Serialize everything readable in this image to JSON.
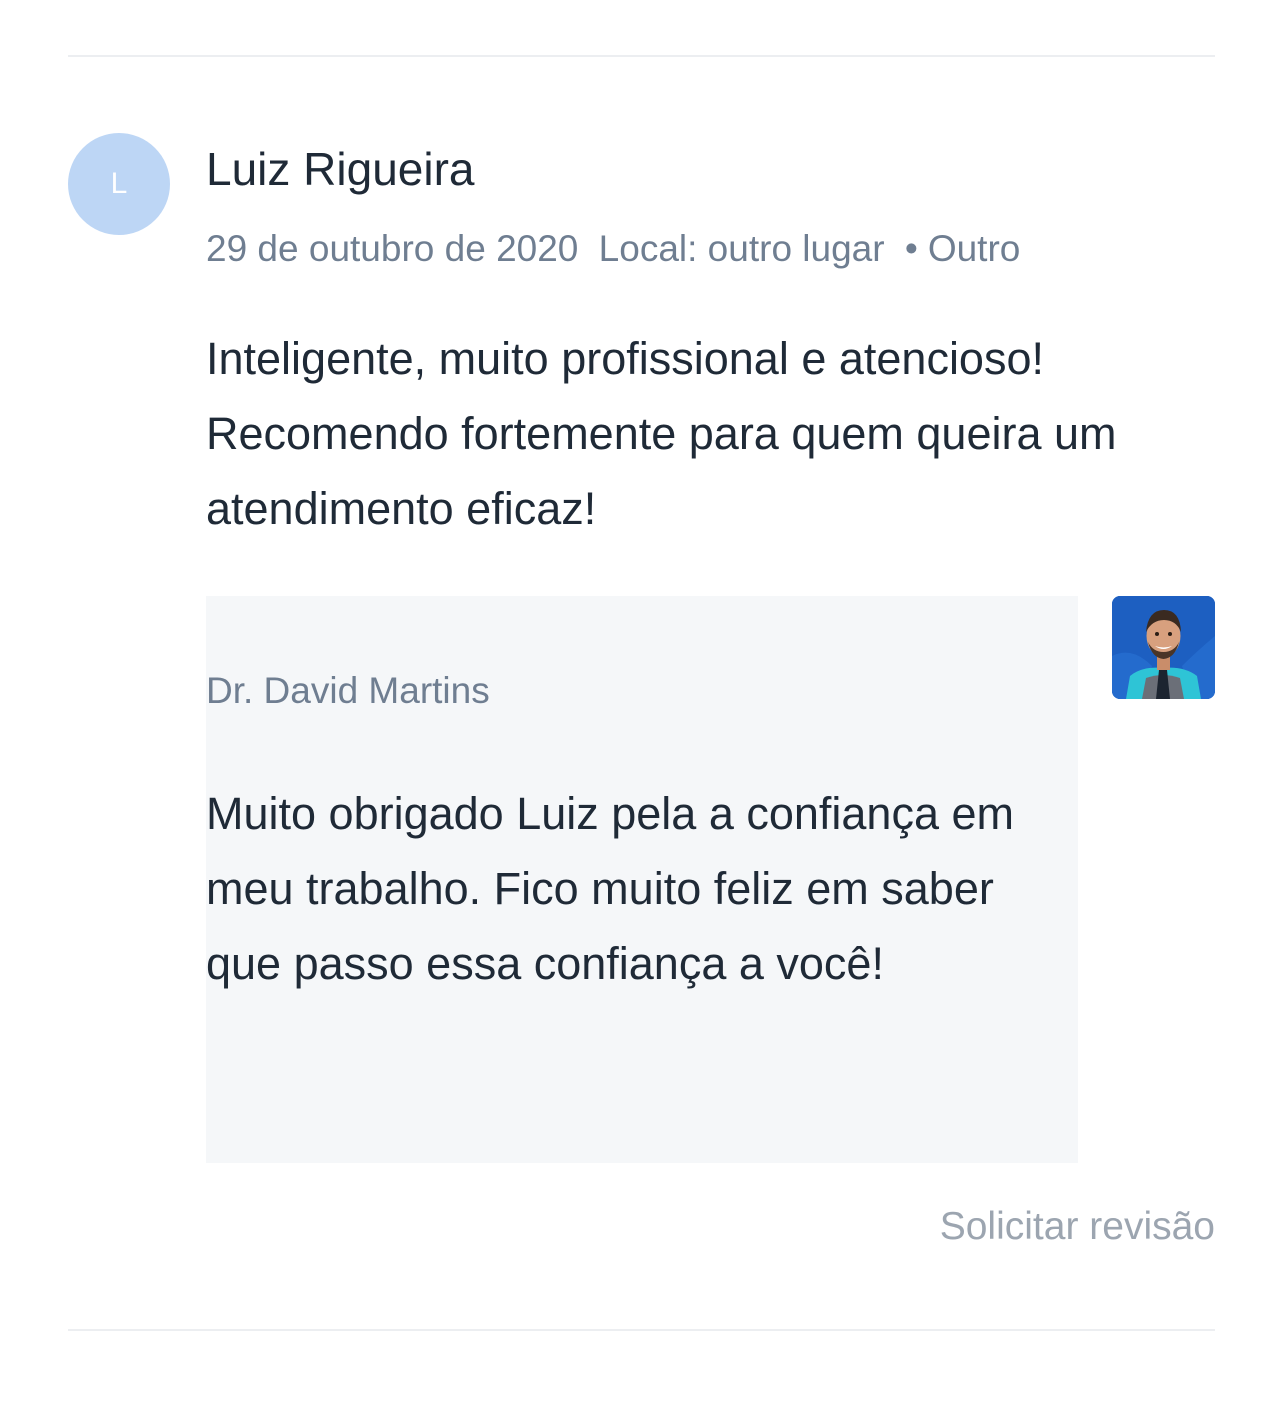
{
  "review": {
    "avatar_initial": "L",
    "reviewer_name": "Luiz Rigueira",
    "date": "29 de outubro de 2020",
    "location": "Local: outro lugar",
    "separator": "•",
    "category": "Outro",
    "text": "Inteligente, muito profissional e atencioso! Recomendo fortemente para quem queira um atendimento eficaz!"
  },
  "reply": {
    "author": "Dr. David Martins",
    "text": "Muito obrigado Luiz pela a confiança em meu trabalho. Fico muito feliz em saber que passo essa confiança a você!"
  },
  "actions": {
    "request_review_label": "Solicitar revisão"
  },
  "colors": {
    "avatar_bg": "#bdd6f5",
    "reply_bg": "#f5f7f9",
    "meta_text": "#6f7e91",
    "photo_bg": "#1d5fc1"
  }
}
